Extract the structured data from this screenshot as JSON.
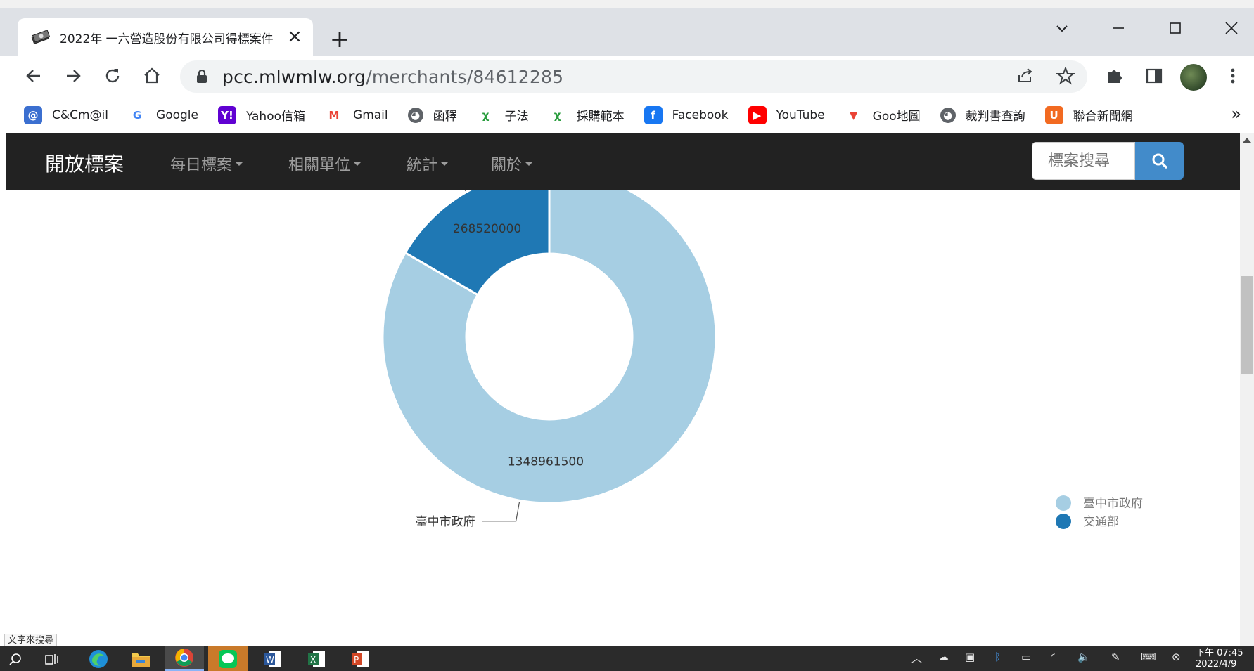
{
  "browser": {
    "tab_title": "2022年 一六營造股份有限公司得標案件",
    "url_domain": "pcc.mlwmlw.org",
    "url_path": "/merchants/84612285",
    "new_tab_symbol": "+",
    "bookmarks": [
      {
        "label": "C&Cm@il",
        "icon": "mail-badge-icon",
        "color": "#3b6fd0"
      },
      {
        "label": "Google",
        "icon": "google-icon",
        "color": "#ffffff"
      },
      {
        "label": "Yahoo信箱",
        "icon": "yahoo-icon",
        "color": "#6001d2"
      },
      {
        "label": "Gmail",
        "icon": "gmail-icon",
        "color": "#ffffff"
      },
      {
        "label": "函釋",
        "icon": "globe-icon",
        "color": "#5f6368"
      },
      {
        "label": "子法",
        "icon": "pcc-logo-icon",
        "color": "#ffffff"
      },
      {
        "label": "採購範本",
        "icon": "pcc-logo-icon",
        "color": "#ffffff"
      },
      {
        "label": "Facebook",
        "icon": "facebook-icon",
        "color": "#1877f2"
      },
      {
        "label": "YouTube",
        "icon": "youtube-icon",
        "color": "#ff0000"
      },
      {
        "label": "Goo地圖",
        "icon": "maps-pin-icon",
        "color": "#ffffff"
      },
      {
        "label": "裁判書查詢",
        "icon": "globe-icon",
        "color": "#5f6368"
      },
      {
        "label": "聯合新聞網",
        "icon": "udn-icon",
        "color": "#f26a21"
      }
    ],
    "bookmarks_more": "»"
  },
  "site": {
    "brand": "開放標案",
    "nav": [
      {
        "label": "每日標案"
      },
      {
        "label": "相關單位"
      },
      {
        "label": "統計"
      },
      {
        "label": "關於"
      }
    ],
    "search_placeholder": "標案搜尋"
  },
  "chart_data": {
    "type": "pie",
    "donut": true,
    "title": "",
    "series": [
      {
        "name": "臺中市政府",
        "value": 1348961500,
        "value_label": "1348961500",
        "color": "#a6cee3"
      },
      {
        "name": "交通部",
        "value": 268520000,
        "value_label": "268520000",
        "color": "#1f78b4"
      }
    ],
    "legend_position": "right"
  },
  "status_tip": "文字來搜尋",
  "taskbar": {
    "clock_time": "下午 07:45",
    "clock_date": "2022/4/9"
  }
}
